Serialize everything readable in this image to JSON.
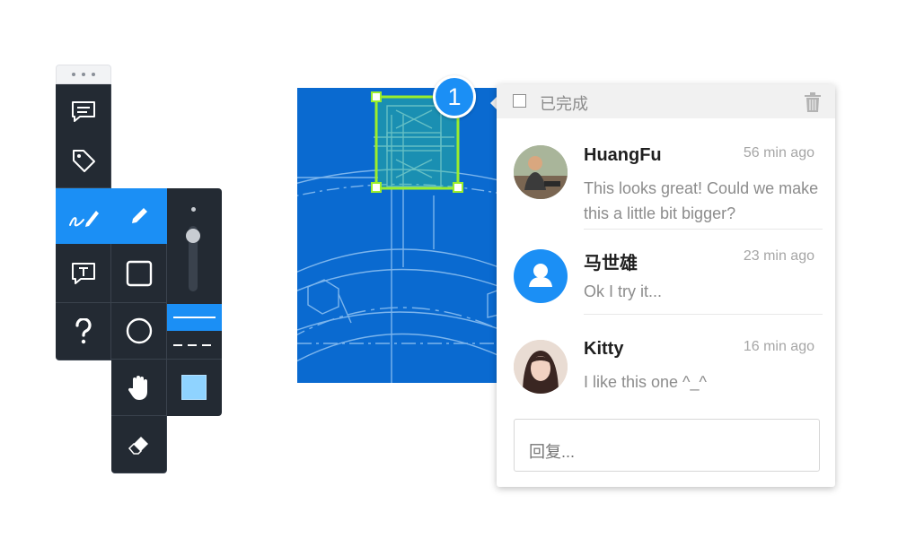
{
  "toolbar": {
    "tools": [
      {
        "icon": "comment-icon"
      },
      {
        "icon": "tag-icon"
      },
      {
        "icon": "draw-icon",
        "active": true
      },
      {
        "icon": "text-box-icon"
      },
      {
        "icon": "help-icon"
      }
    ],
    "shapes": [
      {
        "icon": "pencil-icon",
        "active": true
      },
      {
        "icon": "rectangle-icon"
      },
      {
        "icon": "circle-icon"
      },
      {
        "icon": "hand-icon"
      },
      {
        "icon": "eraser-icon"
      }
    ],
    "line_styles": [
      "solid",
      "dashed"
    ],
    "selected_line_style": "solid",
    "current_color": "#8fd3ff",
    "accent": "#1b8ff5"
  },
  "annotation": {
    "badge_number": "1",
    "selection_color": "#9bee2c"
  },
  "comment_panel": {
    "done_label": "已完成",
    "comments": [
      {
        "name": "HuangFu",
        "time": "56 min ago",
        "text": "This looks great! Could we make this a little bit bigger?",
        "avatar": "photo"
      },
      {
        "name": "马世雄",
        "time": "23 min ago",
        "text": "Ok I try it...",
        "avatar": "default-user-icon"
      },
      {
        "name": "Kitty",
        "time": "16 min ago",
        "text": "I like this one ^_^",
        "avatar": "photo"
      }
    ],
    "reply_placeholder": "回复..."
  }
}
